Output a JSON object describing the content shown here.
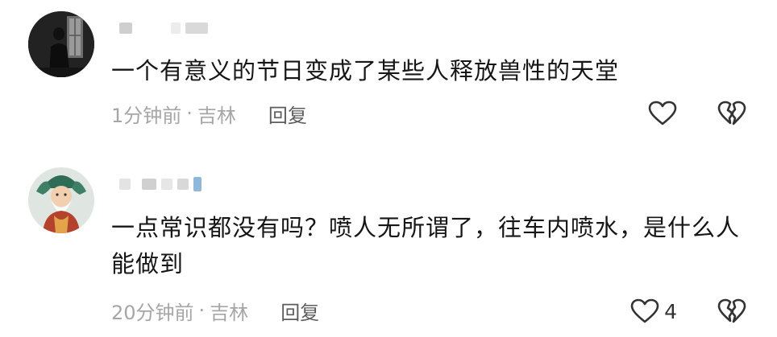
{
  "comments": [
    {
      "username": "",
      "text": "一个有意义的节日变成了某些人释放兽性的天堂",
      "time": "1分钟前",
      "location": "吉林",
      "reply_label": "回复",
      "like_count": "",
      "avatar_icon": "dark-figure-avatar"
    },
    {
      "username": "",
      "text": "一点常识都没有吗？喷人无所谓了，往车内喷水，是什么人能做到",
      "time": "20分钟前",
      "location": "吉林",
      "reply_label": "回复",
      "like_count": "4",
      "avatar_icon": "cartoon-deity-avatar"
    }
  ],
  "separator": "·",
  "colors": {
    "text": "#161616",
    "meta": "#a6a6a6",
    "reply": "#5d5d5d",
    "icon": "#333333"
  },
  "icons": {
    "like": "heart-outline-icon",
    "dislike": "broken-heart-icon"
  }
}
